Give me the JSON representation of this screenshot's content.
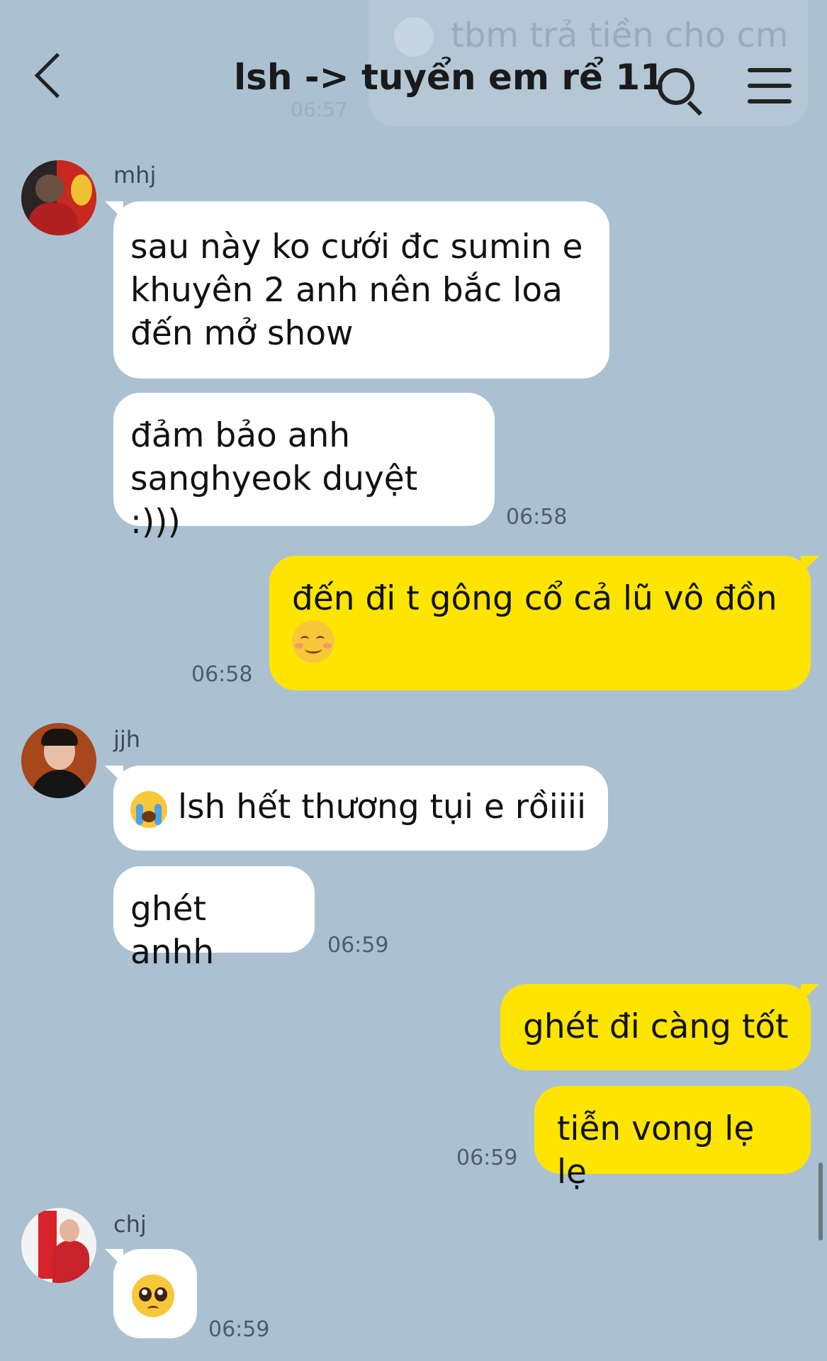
{
  "header": {
    "title": "lsh -> tuyển em rể 11",
    "back_icon": "chevron-left-icon",
    "search_icon": "search-icon",
    "menu_icon": "hamburger-menu-icon"
  },
  "pinned_notice": {
    "text": "tbm trả tiền cho cm",
    "time": "06:57",
    "icon": "emoji-icon"
  },
  "messages": [
    {
      "sender": "mhj",
      "bubbles": [
        "sau này ko cưới đc sumin e khuyên 2 anh nên bắc loa đến mở show",
        "đảm bảo anh sanghyeok duyệt :)))"
      ],
      "time": "06:58"
    },
    {
      "sender": "me",
      "bubbles": [
        "đến đi t gông cổ cả lũ vô đồn"
      ],
      "emoji": "smiling-face-icon",
      "time": "06:58"
    },
    {
      "sender": "jjh",
      "bubbles": [
        "lsh hết thương tụi e rồiiii",
        "ghét anhh"
      ],
      "emoji": "loudly-crying-face-icon",
      "time": "06:59"
    },
    {
      "sender": "me",
      "bubbles": [
        "ghét đi càng tốt",
        "tiễn vong lẹ lẹ"
      ],
      "time": "06:59"
    },
    {
      "sender": "chj",
      "bubbles": [],
      "emoji": "pleading-face-icon",
      "time": "06:59"
    }
  ],
  "colors": {
    "background": "#abc1d1",
    "my_bubble": "#fee500",
    "other_bubble": "#ffffff"
  }
}
